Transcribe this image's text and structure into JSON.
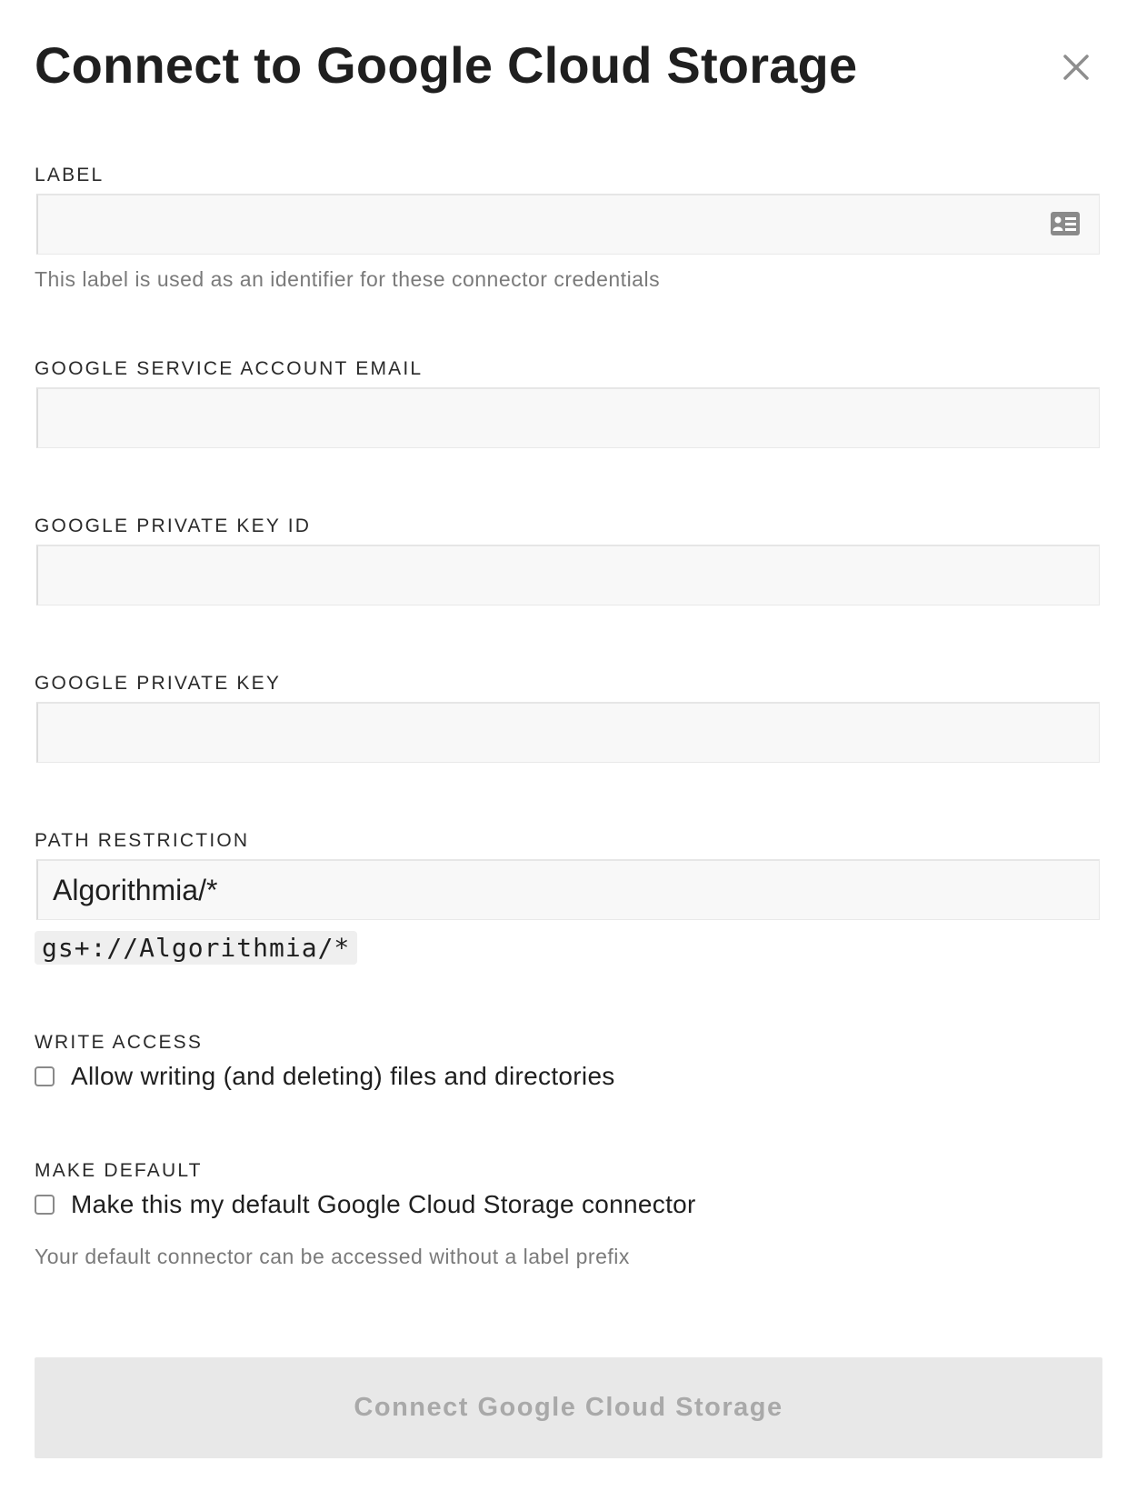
{
  "dialog": {
    "title": "Connect to Google Cloud Storage",
    "close_icon": "close-icon"
  },
  "fields": {
    "label": {
      "label": "LABEL",
      "value": "",
      "placeholder": "",
      "icon": "contact-card-icon",
      "help": "This label is used as an identifier for these connector credentials"
    },
    "service_account_email": {
      "label": "GOOGLE SERVICE ACCOUNT EMAIL",
      "value": "",
      "placeholder": ""
    },
    "private_key_id": {
      "label": "GOOGLE PRIVATE KEY ID",
      "value": "",
      "placeholder": ""
    },
    "private_key": {
      "label": "GOOGLE PRIVATE KEY",
      "value": "",
      "placeholder": ""
    },
    "path_restriction": {
      "label": "PATH RESTRICTION",
      "value": "Algorithmia/*",
      "preview": "gs+://Algorithmia/*"
    }
  },
  "write_access": {
    "label": "WRITE ACCESS",
    "checkbox_text": "Allow writing (and deleting) files and directories",
    "checked": false
  },
  "make_default": {
    "label": "MAKE DEFAULT",
    "checkbox_text": "Make this my default Google Cloud Storage connector",
    "checked": false,
    "help": "Your default connector can be accessed without a label prefix"
  },
  "submit": {
    "label": "Connect Google Cloud Storage",
    "enabled": false
  },
  "colors": {
    "input_bg": "#f8f8f8",
    "button_disabled_bg": "#e8e8e8",
    "button_disabled_text": "#a9a9a9",
    "help_text": "#7a7a7a"
  }
}
